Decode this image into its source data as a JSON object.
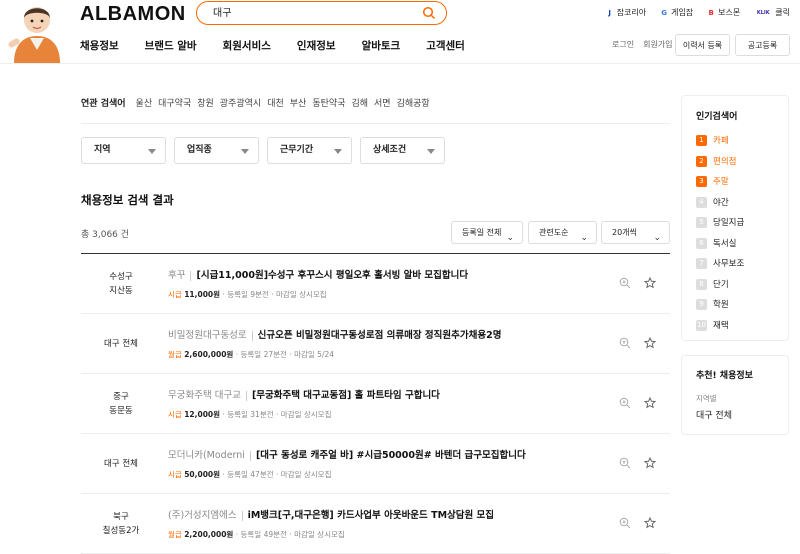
{
  "header": {
    "logo_text": "ALBAMON",
    "search": {
      "value": "대구"
    },
    "partners": [
      {
        "label": "잡코리아",
        "icon": "J",
        "color": "#1b3fb8"
      },
      {
        "label": "게임잡",
        "icon": "G",
        "color": "#3a7bd5"
      },
      {
        "label": "보스몬",
        "icon": "B",
        "color": "#e63030"
      },
      {
        "label": "클릭",
        "icon": "KLIK",
        "color": "#3b2aa8"
      }
    ],
    "nav": [
      "채용정보",
      "브랜드 알바",
      "회원서비스",
      "인재정보",
      "알바토크",
      "고객센터"
    ],
    "util": {
      "login": "로그인",
      "join": "회원가입"
    },
    "resume_btn": "이력서 등록",
    "post_btn": "공고등록"
  },
  "related": {
    "title": "연관 검색어",
    "items": [
      "울산",
      "대구약국",
      "창원",
      "광주광역시",
      "대천",
      "부산",
      "동탄약국",
      "김해",
      "서면",
      "김해공항"
    ]
  },
  "filters": [
    "지역",
    "업직종",
    "근무기간",
    "상세조건"
  ],
  "results": {
    "title": "채용정보 검색 결과",
    "count": "총 3,066 건",
    "sort_date": "등록일 전체",
    "sort_rel": "관련도순",
    "per_page": "20개씩",
    "rows": [
      {
        "loc1": "수성구",
        "loc2": "지산동",
        "company": "후꾸",
        "title": "[시급11,000원]수성구 후꾸스시 평일오후 홀서빙 알바 모집합니다",
        "pay_type": "시급",
        "pay": "11,000원",
        "reg": "등록일 9분전",
        "deadline": "마감일 상시모집"
      },
      {
        "loc1": "대구 전체",
        "loc2": "",
        "company": "비밀정원대구동성로",
        "title": "신규오픈 비밀정원대구동성로점 의류매장 정직원추가채용2명",
        "pay_type": "월급",
        "pay": "2,600,000원",
        "reg": "등록일 27분전",
        "deadline": "마감일 5/24"
      },
      {
        "loc1": "중구",
        "loc2": "동문동",
        "company": "무궁화주택 대구교",
        "title": "[무궁화주택 대구교동점] 홀 파트타임 구합니다",
        "pay_type": "시급",
        "pay": "12,000원",
        "reg": "등록일 31분전",
        "deadline": "마감일 상시모집"
      },
      {
        "loc1": "대구 전체",
        "loc2": "",
        "company": "모더니카(Moderni",
        "title": "[대구 동성로 캐주얼 바] #시급50000원# 바텐더 급구모집합니다",
        "pay_type": "시급",
        "pay": "50,000원",
        "reg": "등록일 47분전",
        "deadline": "마감일 상시모집"
      },
      {
        "loc1": "북구",
        "loc2": "칠성동2가",
        "company": "(주)거성지엠에스",
        "title": "iM뱅크[구,대구은행] 카드사업부 아웃바운드 TM상담원 모집",
        "pay_type": "월급",
        "pay": "2,200,000원",
        "reg": "등록일 49분전",
        "deadline": "마감일 상시모집"
      }
    ]
  },
  "popular": {
    "title": "인기검색어",
    "items": [
      "카페",
      "편의점",
      "주말",
      "야간",
      "당일지급",
      "독서실",
      "사무보조",
      "단기",
      "학원",
      "재택"
    ]
  },
  "recommend": {
    "title": "추천! 채용정보",
    "label": "지역별",
    "value": "대구 전체"
  },
  "colors": {
    "accent": "#ff6a00"
  }
}
